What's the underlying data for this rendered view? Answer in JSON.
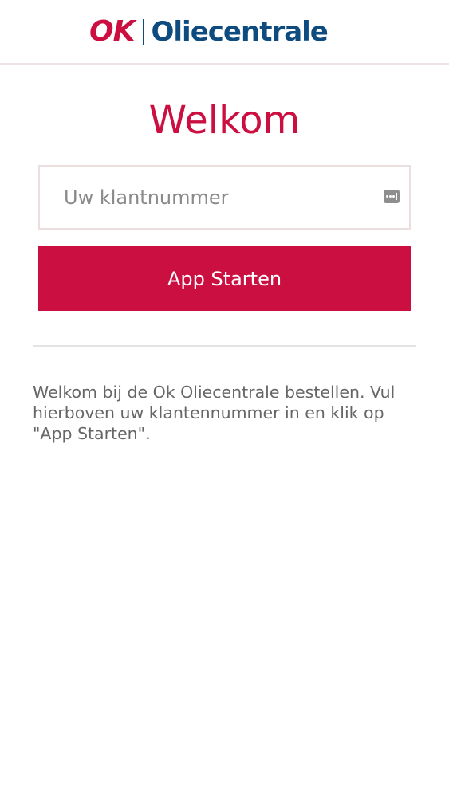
{
  "colors": {
    "brand_red": "#cc0f41",
    "brand_blue": "#0e4c80",
    "text_gray": "#666666"
  },
  "header": {
    "logo_ok": "OK",
    "logo_name": "Oliecentrale"
  },
  "main": {
    "title": "Welkom",
    "customer_input": {
      "placeholder": "Uw klantnummer",
      "value": "",
      "autofill_icon": "keychain-autofill-icon"
    },
    "start_button_label": "App Starten",
    "intro_text": "Welkom bij de Ok Oliecentrale bestellen. Vul hierboven uw klantennummer in en klik op \"App Starten\"."
  }
}
